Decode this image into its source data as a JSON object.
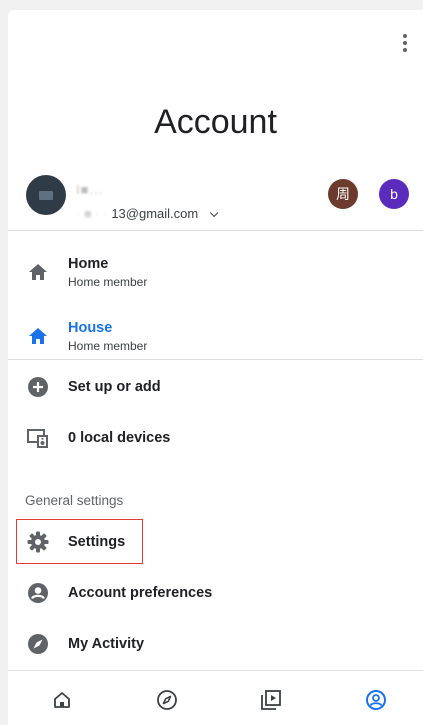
{
  "header": {
    "title": "Account"
  },
  "account": {
    "name": "I■...",
    "email_masked": "·  ■  ·  ·",
    "email_visible": "13@gmail.com",
    "other_accounts": [
      "周",
      "b"
    ]
  },
  "homes": [
    {
      "label": "Home",
      "sub": "Home member"
    },
    {
      "label": "House",
      "sub": "Home member"
    }
  ],
  "actions": [
    {
      "label": "Set up or add"
    },
    {
      "label": "0 local devices"
    }
  ],
  "general": {
    "section_label": "General settings",
    "items": [
      {
        "label": "Settings"
      },
      {
        "label": "Account preferences"
      },
      {
        "label": "My Activity"
      }
    ]
  },
  "colors": {
    "accent": "#1a73e8",
    "icon": "#5f6368",
    "highlight": "#e53935",
    "chip1": "#6d3b2e",
    "chip2": "#5b2bbd"
  },
  "icons": [
    "more-vert-icon",
    "home-icon",
    "add-circle-icon",
    "local-devices-icon",
    "settings-gear-icon",
    "account-circle-icon",
    "compass-icon",
    "nav-home-icon",
    "nav-explore-icon",
    "nav-media-icon",
    "nav-account-icon"
  ]
}
